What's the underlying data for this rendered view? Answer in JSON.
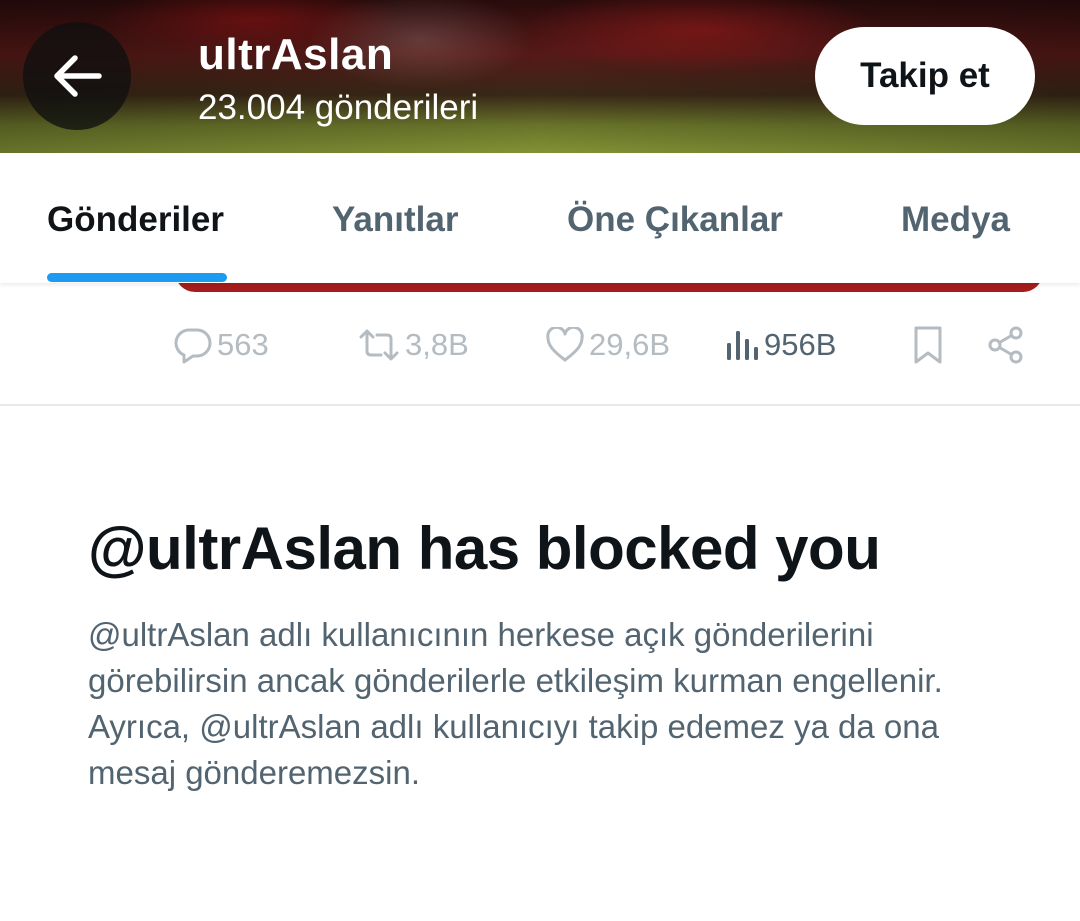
{
  "header": {
    "title": "ultrAslan",
    "post_count": "23.004 gönderileri",
    "follow_label": "Takip et"
  },
  "tabs": [
    {
      "label": "Gönderiler",
      "active": true
    },
    {
      "label": "Yanıtlar",
      "active": false
    },
    {
      "label": "Öne Çıkanlar",
      "active": false
    },
    {
      "label": "Medya",
      "active": false
    }
  ],
  "post_actions": {
    "replies": "563",
    "reposts": "3,8B",
    "likes": "29,6B",
    "views": "956B"
  },
  "blocked": {
    "title": "@ultrAslan has blocked you",
    "description": "@ultrAslan adlı kullanıcının herkese açık gönderilerini görebilirsin ancak gönderilerle etkileşim kurman engellenir. Ayrıca, @ultrAslan adlı kullanıcıyı takip edemez ya da ona mesaj gönderemezsin."
  },
  "colors": {
    "accent": "#1d9bf0",
    "text_primary": "#0f1419",
    "text_secondary": "#536471",
    "banner_red": "#a51c1c"
  },
  "icons": [
    "back-arrow-icon",
    "reply-icon",
    "repost-icon",
    "like-icon",
    "views-icon",
    "bookmark-icon",
    "share-icon"
  ]
}
